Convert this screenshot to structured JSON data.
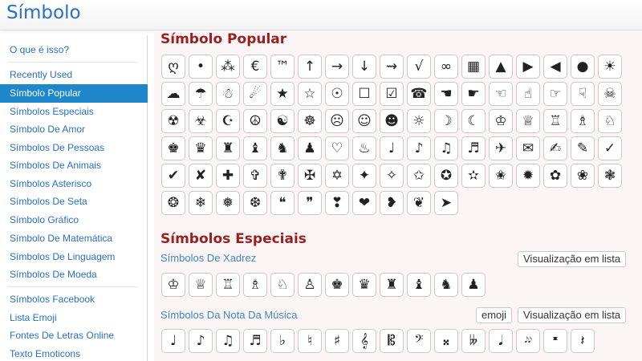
{
  "header": {
    "brand": "Símbolo"
  },
  "sidebar": {
    "items": [
      {
        "label": "O que é isso?",
        "active": false
      },
      {
        "label": "Recently Used",
        "active": false
      },
      {
        "label": "Símbolo Popular",
        "active": true
      },
      {
        "label": "Símbolos Especiais",
        "active": false
      },
      {
        "label": "Símbolo De Amor",
        "active": false
      },
      {
        "label": "Símbolos De Pessoas",
        "active": false
      },
      {
        "label": "Símbolos De Animais",
        "active": false
      },
      {
        "label": "Símbolos Asterisco",
        "active": false
      },
      {
        "label": "Símbolos De Seta",
        "active": false
      },
      {
        "label": "Símbolo Gráfico",
        "active": false
      },
      {
        "label": "Símbolo De Matemática",
        "active": false
      },
      {
        "label": "Símbolos De Linguagem",
        "active": false
      },
      {
        "label": "Símbolos De Moeda",
        "active": false
      },
      {
        "label": "Símbolos Facebook",
        "active": false
      },
      {
        "label": "Lista Emoji",
        "active": false
      },
      {
        "label": "Fontes De Letras Online",
        "active": false
      },
      {
        "label": "Texto Emoticons",
        "active": false
      }
    ]
  },
  "popular": {
    "title": "Símbolo Popular",
    "symbols": [
      "ღ",
      "•",
      "⁂",
      "€",
      "™",
      "↑",
      "→",
      "↓",
      "⇝",
      "√",
      "∞",
      "▦",
      "▲",
      "▶",
      "◀",
      "●",
      "☀",
      "☁",
      "☂",
      "☃",
      "☄",
      "★",
      "☆",
      "☉",
      "☐",
      "☑",
      "☎",
      "☚",
      "☛",
      "☜",
      "☝",
      "☞",
      "☟",
      "☠",
      "☢",
      "☣",
      "☪",
      "☮",
      "☯",
      "☸",
      "☹",
      "☺",
      "☻",
      "☼",
      "☽",
      "☾",
      "♔",
      "♕",
      "♖",
      "♗",
      "♘",
      "♚",
      "♛",
      "♜",
      "♝",
      "♞",
      "♟",
      "♡",
      "♨",
      "♩",
      "♪",
      "♫",
      "♬",
      "✈",
      "✉",
      "✍",
      "✎",
      "✓",
      "✔",
      "✘",
      "✚",
      "✞",
      "✟",
      "✠",
      "✡",
      "✦",
      "✧",
      "✩",
      "✪",
      "✫",
      "✬",
      "✹",
      "✿",
      "❀",
      "❃",
      "❂",
      "❄",
      "❅",
      "❆",
      "❝",
      "❞",
      "❣",
      "❤",
      "❥",
      "❦",
      "➤"
    ]
  },
  "special": {
    "title": "Símbolos Especiais",
    "chess": {
      "title": "Símbolos De Xadrez",
      "list_view_label": "Visualização em lista",
      "symbols": [
        "♔",
        "♕",
        "♖",
        "♗",
        "♘",
        "♙",
        "♚",
        "♛",
        "♜",
        "♝",
        "♞",
        "♟"
      ]
    },
    "music": {
      "title": "Símbolos Da Nota Da Música",
      "emoji_label": "emoji",
      "list_view_label": "Visualização em lista",
      "symbols": [
        "♩",
        "♪",
        "♫",
        "♬",
        "♭",
        "♮",
        "♯",
        "𝄞",
        "𝄡",
        "𝄢",
        "𝄪",
        "𝄫",
        "𝅘𝅥",
        "𝅘𝅥𝅮𝅘𝅥𝅮",
        "𝄺",
        "𝄽"
      ]
    }
  }
}
